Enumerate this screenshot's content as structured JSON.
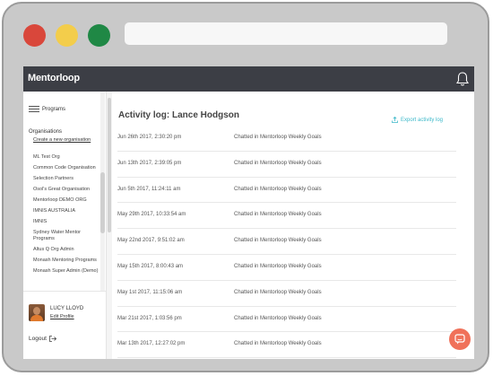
{
  "app": {
    "brand": "Mentorloop"
  },
  "sidebar": {
    "programs_label": "Programs",
    "organisations_label": "Organisations",
    "create_org_label": "Create a new organisation",
    "organisations": [
      "ML Test Org",
      "Common Code Organisation",
      "Selection Partners",
      "Osol's Great Organisation",
      "Mentorloop DEMO ORG",
      "IMNIS AUSTRALIA",
      "IMNIS",
      "Sydney Water Mentor Programs",
      "Altus Q Org Admin",
      "Monash Mentoring Programs",
      "Monash Super Admin (Demo)"
    ],
    "user": {
      "name": "LUCY LLOYD",
      "edit_label": "Edit Profile"
    },
    "logout_label": "Logout"
  },
  "main": {
    "title": "Activity log: Lance Hodgson",
    "export_label": "Export activity log",
    "rows": [
      {
        "date": "Jun 26th 2017, 2:30:20 pm",
        "desc": "Chatted in Mentorloop Weekly Goals"
      },
      {
        "date": "Jun 13th 2017, 2:39:05 pm",
        "desc": "Chatted in Mentorloop Weekly Goals"
      },
      {
        "date": "Jun 5th 2017, 11:24:11 am",
        "desc": "Chatted in Mentorloop Weekly Goals"
      },
      {
        "date": "May 29th 2017, 10:33:54 am",
        "desc": "Chatted in Mentorloop Weekly Goals"
      },
      {
        "date": "May 22nd 2017, 9:51:02 am",
        "desc": "Chatted in Mentorloop Weekly Goals"
      },
      {
        "date": "May 15th 2017, 8:00:43 am",
        "desc": "Chatted in Mentorloop Weekly Goals"
      },
      {
        "date": "May 1st 2017, 11:15:06 am",
        "desc": "Chatted in Mentorloop Weekly Goals"
      },
      {
        "date": "Mar 21st 2017, 1:03:56 pm",
        "desc": "Chatted in Mentorloop Weekly Goals"
      },
      {
        "date": "Mar 13th 2017, 12:27:02 pm",
        "desc": "Chatted in Mentorloop Weekly Goals"
      }
    ]
  },
  "colors": {
    "topbar": "#3c3e45",
    "accent": "#3bb8c9",
    "chat_button": "#f0715a",
    "window_red": "#d9473b",
    "window_yellow": "#f3cd4b",
    "window_green": "#1f8845"
  },
  "icons": [
    "bell-icon",
    "menu-icon",
    "export-icon",
    "logout-icon",
    "chat-icon"
  ]
}
